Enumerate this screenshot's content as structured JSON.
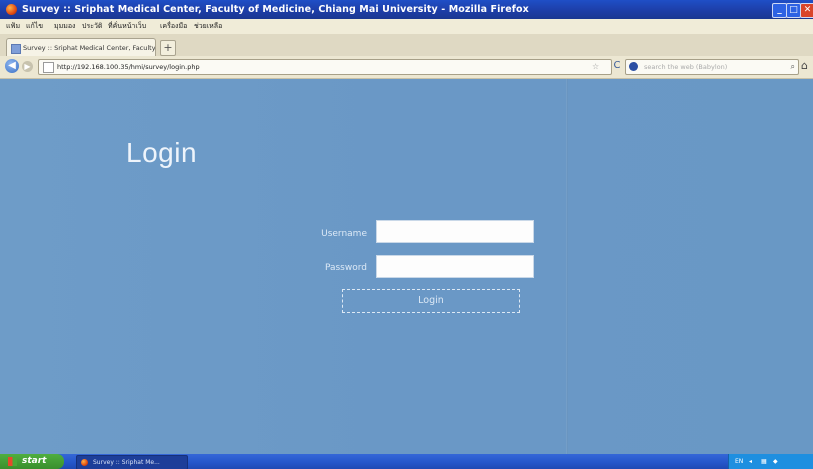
{
  "window": {
    "title": "Survey :: Sriphat Medical Center, Faculty of Medicine, Chiang Mai University - Mozilla Firefox",
    "controls": {
      "minimize": "_",
      "maximize": "□",
      "close": "✕"
    }
  },
  "menubar": {
    "items": [
      "แฟ้ม",
      "แก้ไข",
      "มุมมอง",
      "ประวัติ",
      "ที่คั่นหน้าเว็บ",
      "เครื่องมือ",
      "ช่วยเหลือ"
    ]
  },
  "tabs": {
    "active_label": "Survey :: Sriphat Medical Center, Faculty o...",
    "new_tab": "+"
  },
  "navbar": {
    "back": "◀",
    "forward": "▶",
    "url": "http://192.168.100.35/hmi/survey/login.php",
    "star": "☆",
    "reload": "C",
    "search_placeholder": "search the web (Babylon)",
    "search_button": "⌕",
    "home": "⌂"
  },
  "login_page": {
    "title": "Login",
    "username_label": "Username",
    "password_label": "Password",
    "username_value": "",
    "password_value": "",
    "login_button": "Login"
  },
  "taskbar": {
    "start_label": "start",
    "task_label": "Survey :: Sriphat Me...",
    "tray_lang": "EN",
    "tray_time": ""
  },
  "colors": {
    "page_background": "#6b9bc9",
    "titlebar": "#1d3ea8",
    "taskbar": "#2455c9",
    "start_button": "#3a8f2d"
  }
}
